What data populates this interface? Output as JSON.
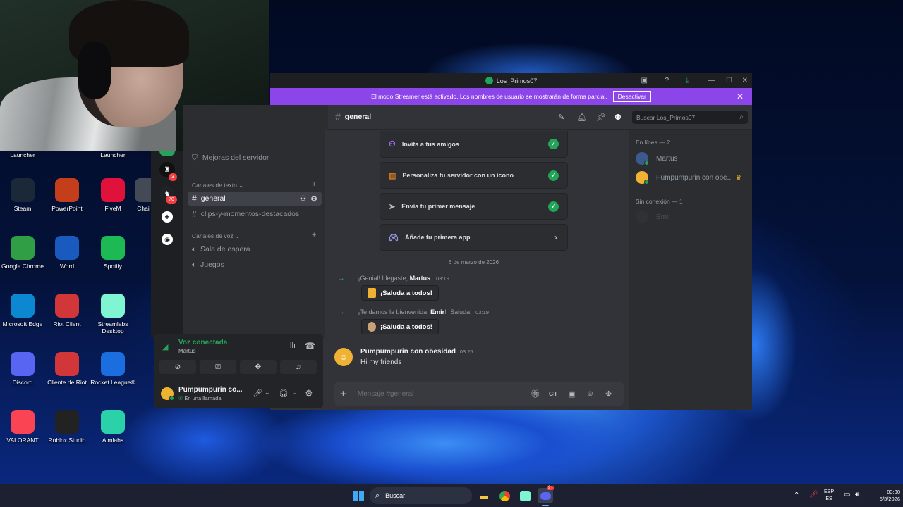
{
  "desktop": {
    "top_labels": [
      "Launcher",
      "Launcher"
    ],
    "icons": [
      {
        "label": "Steam",
        "icon": "steam-icon",
        "color": "#1b2838"
      },
      {
        "label": "PowerPoint",
        "icon": "powerpoint-icon",
        "color": "#c43e1c"
      },
      {
        "label": "FiveM",
        "icon": "fivem-icon",
        "color": "#e0113a"
      },
      {
        "label": "Chai",
        "icon": "chai-icon",
        "color": "#444a55"
      },
      {
        "label": "Google Chrome",
        "icon": "chrome-icon",
        "color": "#2f9e44"
      },
      {
        "label": "Word",
        "icon": "word-icon",
        "color": "#185abd"
      },
      {
        "label": "Spotify",
        "icon": "spotify-icon",
        "color": "#1db954"
      },
      {
        "label": "Microsoft Edge",
        "icon": "edge-icon",
        "color": "#0c88d1"
      },
      {
        "label": "Riot Client",
        "icon": "riot-icon",
        "color": "#d13639"
      },
      {
        "label": "Streamlabs Desktop",
        "icon": "streamlabs-icon",
        "color": "#80f5d2"
      },
      {
        "label": "Discord",
        "icon": "discord-icon",
        "color": "#5865f2"
      },
      {
        "label": "Cliente de Riot",
        "icon": "riot-icon",
        "color": "#d13639"
      },
      {
        "label": "Rocket League®",
        "icon": "rocket-league-icon",
        "color": "#1a6ee0"
      },
      {
        "label": "VALORANT",
        "icon": "valorant-icon",
        "color": "#fa4454"
      },
      {
        "label": "Roblox Studio",
        "icon": "roblox-icon",
        "color": "#222222"
      },
      {
        "label": "Aimlabs",
        "icon": "aimlabs-icon",
        "color": "#2bd1a8"
      }
    ]
  },
  "window": {
    "title": "Los_Primos07",
    "banner_text": "El modo Streamer está activado. Los nombres de usuario se mostrarán de forma parcial.",
    "banner_button": "Desactivar"
  },
  "servers": {
    "badge_a": "3",
    "badge_b": "70"
  },
  "channels": {
    "boost": "Mejoras del servidor",
    "text_category": "Canales de texto",
    "text_channels": [
      "general",
      "clips-y-momentos-destacados"
    ],
    "voice_category": "Canales de voz",
    "voice_channels": [
      "Sala de espera",
      "Juegos"
    ]
  },
  "voice": {
    "status": "Voz conectada",
    "channel": "Martus",
    "user_name": "Pumpumpurin co...",
    "user_status": "En una llamada"
  },
  "chat": {
    "channel_name": "general",
    "search_placeholder": "Buscar Los_Primos07",
    "cards": [
      {
        "label": "Invita a tus amigos",
        "done": true
      },
      {
        "label": "Personaliza tu servidor con un icono",
        "done": true
      },
      {
        "label": "Envía tu primer mensaje",
        "done": true
      },
      {
        "label": "Añade tu primera app",
        "done": false
      }
    ],
    "date_divider": "6 de marzo de 2026",
    "join1": {
      "pre": "¡Genial! Llegaste, ",
      "user": "Martus",
      "post": ".",
      "time": "03:19",
      "button": "¡Saluda a todos!"
    },
    "join2": {
      "pre": "¡Te damos la bienvenida, ",
      "user": "Emir",
      "post": "! ¡Saluda!",
      "time": "03:19",
      "button": "¡Saluda a todos!"
    },
    "message": {
      "author": "Pumpumpurin con obesidad",
      "time": "03:25",
      "text": "Hi my friends"
    },
    "composer_placeholder": "Mensaje #general"
  },
  "members": {
    "online_header": "En línea — 2",
    "online": [
      "Martus",
      "Pumpumpurin con obe..."
    ],
    "offline_header": "Sin conexión — 1",
    "offline": [
      "Emir"
    ]
  },
  "taskbar": {
    "search": "Buscar",
    "lang1": "ESP",
    "lang2": "ES",
    "time": "03:30",
    "date": "6/3/2026",
    "discord_badge": "9+"
  }
}
